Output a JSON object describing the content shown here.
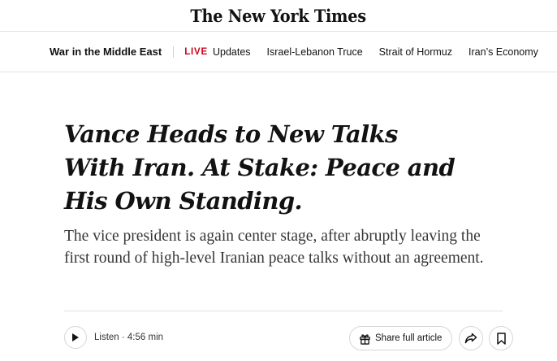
{
  "masthead": {
    "logo_text": "The New York Times"
  },
  "topnav": {
    "section": "War in the Middle East",
    "live_badge": "LIVE",
    "links": [
      "Updates",
      "Israel-Lebanon Truce",
      "Strait of Hormuz",
      "Iran’s Economy"
    ]
  },
  "article": {
    "headline": "Vance Heads to New Talks With Iran. At Stake: Peace and His Own Standing.",
    "summary": "The vice president is again center stage, after abruptly leaving the first round of high-level Iranian peace talks without an agreement."
  },
  "toolbar": {
    "listen_label": "Listen · 4:56 min",
    "share_label": "Share full article"
  },
  "icons": {
    "play": "play-icon",
    "gift": "gift-icon",
    "share": "share-arrow-icon",
    "bookmark": "bookmark-icon"
  },
  "colors": {
    "live_red": "#d0021b",
    "text": "#121212",
    "border": "#e2e2e2"
  }
}
